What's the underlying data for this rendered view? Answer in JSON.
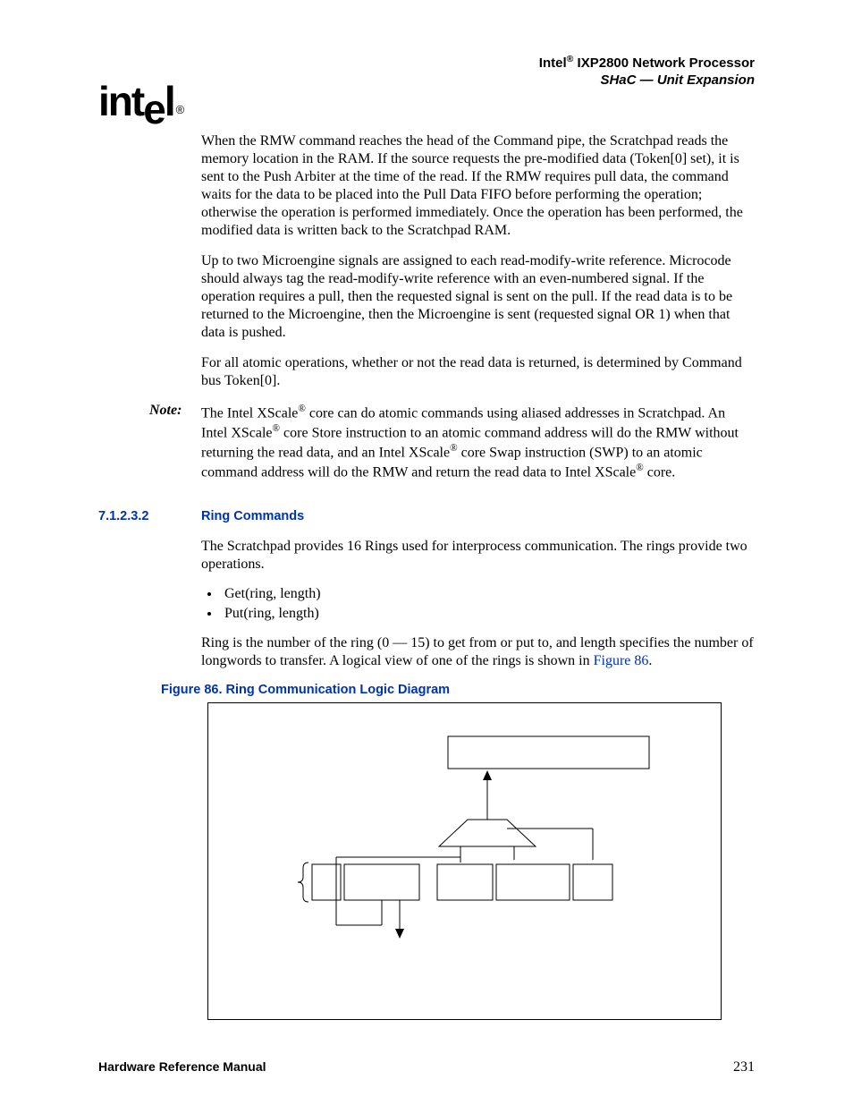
{
  "header": {
    "product_prefix": "Intel",
    "reg": "®",
    "product_suffix": " IXP2800 Network Processor",
    "subtitle": "SHaC — Unit Expansion"
  },
  "logo": {
    "text": "intel",
    "reg": "®"
  },
  "paragraphs": {
    "p1": "When the RMW command reaches the head of the Command pipe, the Scratchpad reads the memory location in the RAM. If the source requests the pre-modified data (Token[0] set), it is sent to the Push Arbiter at the time of the read. If the RMW requires pull data, the command waits for the data to be placed into the Pull Data FIFO before performing the operation; otherwise the operation is performed immediately. Once the operation has been performed, the modified data is written back to the Scratchpad RAM.",
    "p2": "Up to two Microengine signals are assigned to each read-modify-write reference. Microcode should always tag the read-modify-write reference with an even-numbered signal. If the operation requires a pull, then the requested signal is sent on the pull. If the read data is to be returned to the Microengine, then the Microengine is sent (requested signal OR 1) when that data is pushed.",
    "p3": "For all atomic operations, whether or not the read data is returned, is determined by Command bus Token[0].",
    "note_label": "Note:",
    "note_a": "The Intel XScale",
    "note_b": " core can do atomic commands using aliased addresses in Scratchpad. An Intel XScale",
    "note_c": " core Store instruction to an atomic command address will do the RMW without returning the read data, and an Intel XScale",
    "note_d": " core Swap instruction (SWP) to an atomic command address will do the RMW and return the read data to Intel XScale",
    "note_e": " core.",
    "p5": "The Scratchpad provides 16 Rings used for interprocess communication. The rings provide two operations.",
    "p6a": "Ring is the number of the ring (0 — 15) to get from or put to, and length specifies the number of longwords to transfer. A logical view of one of the rings is shown in ",
    "p6b": "Figure 86",
    "p6c": "."
  },
  "section": {
    "number": "7.1.2.3.2",
    "title": "Ring Commands"
  },
  "ops": [
    "Get(ring, length)",
    "Put(ring, length)"
  ],
  "figure": {
    "caption": "Figure 86. Ring Communication Logic Diagram"
  },
  "footer": {
    "left": "Hardware Reference Manual",
    "right": "231"
  }
}
